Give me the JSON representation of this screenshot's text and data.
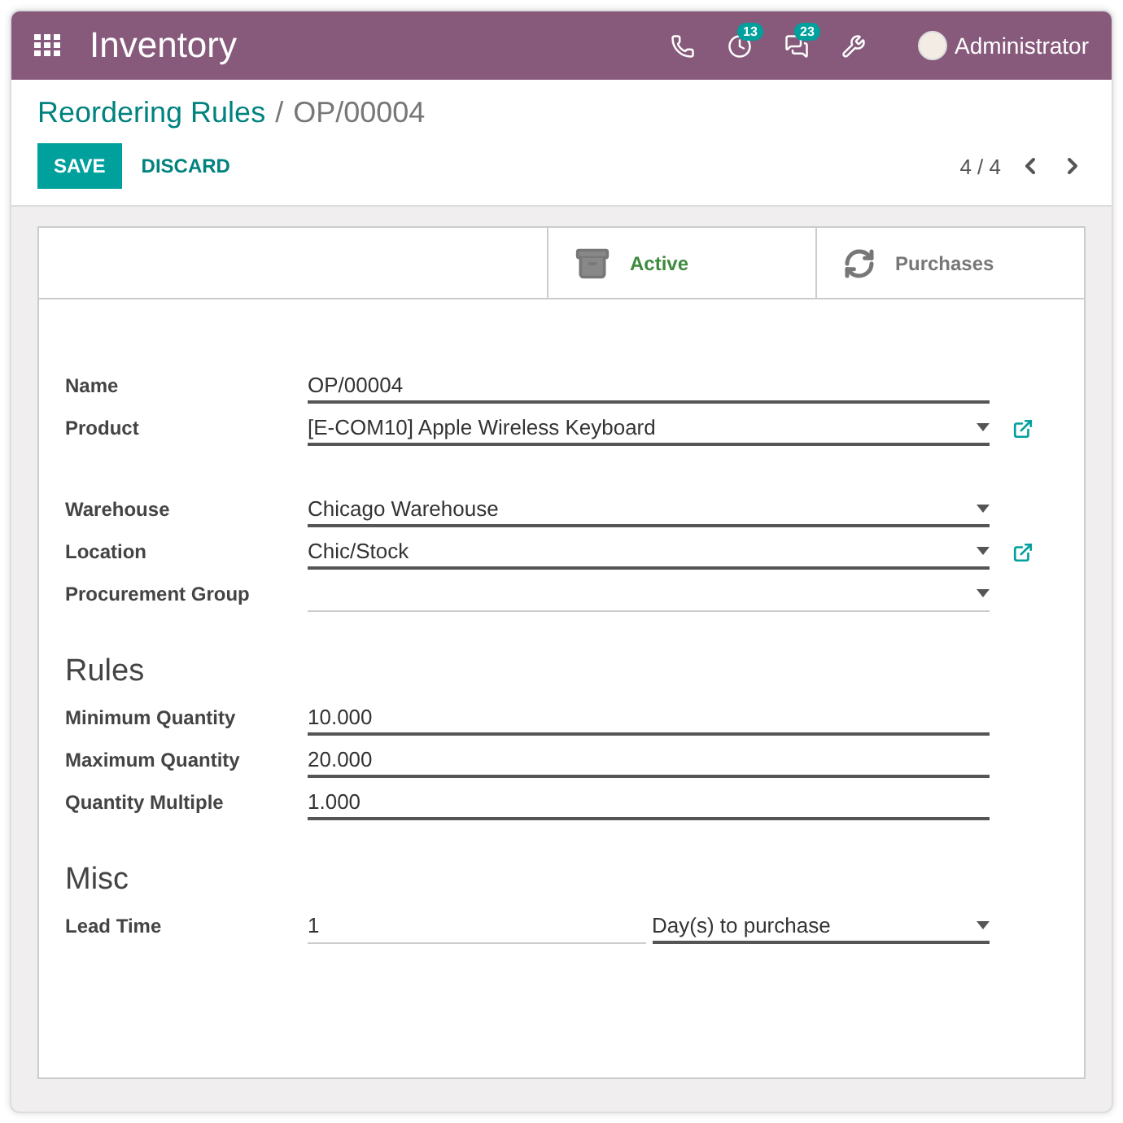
{
  "navbar": {
    "app_title": "Inventory",
    "icons": [
      {
        "kind": "phone"
      },
      {
        "kind": "activity",
        "badge": "13"
      },
      {
        "kind": "chat",
        "badge": "23"
      },
      {
        "kind": "tools"
      }
    ],
    "user": "Administrator"
  },
  "breadcrumb": {
    "parent": "Reordering Rules",
    "separator": "/",
    "current": "OP/00004"
  },
  "buttons": [
    {
      "label": "SAVE",
      "kind": "primary"
    },
    {
      "label": "DISCARD",
      "kind": "link"
    }
  ],
  "pager": "4 / 4",
  "button_box": [
    {
      "kind": "toggle",
      "label": "Active",
      "on": true
    },
    {
      "kind": "stat",
      "label": "Purchases"
    }
  ],
  "sections": [
    {
      "fields": [
        {
          "label": "Name",
          "inputs": [
            {
              "kind": "text",
              "value": "OP/00004",
              "required": true
            }
          ]
        },
        {
          "label": "Product",
          "link": true,
          "inputs": [
            {
              "kind": "select",
              "value": "[E-COM10] Apple Wireless Keyboard",
              "required": true
            }
          ]
        }
      ]
    },
    {
      "fields": [
        {
          "label": "Warehouse",
          "inputs": [
            {
              "kind": "select",
              "value": "Chicago Warehouse",
              "required": true
            }
          ]
        },
        {
          "label": "Location",
          "link": true,
          "inputs": [
            {
              "kind": "select",
              "value": "Chic/Stock",
              "required": true
            }
          ]
        },
        {
          "label": "Procurement Group",
          "inputs": [
            {
              "kind": "select",
              "required": false
            }
          ]
        }
      ]
    },
    {
      "title": "Rules",
      "fields": [
        {
          "label": "Minimum Quantity",
          "inputs": [
            {
              "kind": "text",
              "value": "10.000",
              "required": true
            }
          ]
        },
        {
          "label": "Maximum Quantity",
          "inputs": [
            {
              "kind": "text",
              "value": "20.000",
              "required": true
            }
          ]
        },
        {
          "label": "Quantity Multiple",
          "inputs": [
            {
              "kind": "text",
              "value": "1.000",
              "required": true
            }
          ]
        }
      ]
    },
    {
      "title": "Misc",
      "fields": [
        {
          "label": "Lead Time",
          "inputs": [
            {
              "kind": "text",
              "value": "1",
              "required": false
            },
            {
              "kind": "select",
              "value": "Day(s) to purchase",
              "required": true
            }
          ]
        }
      ]
    }
  ]
}
